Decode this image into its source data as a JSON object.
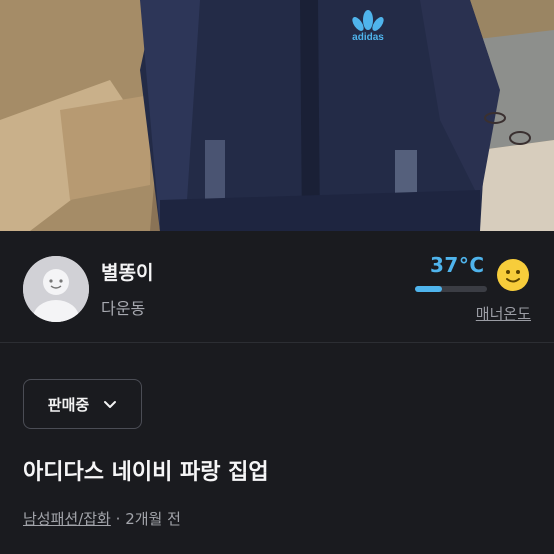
{
  "photo": {
    "brand_text": "adidas"
  },
  "seller": {
    "nickname": "별똥이",
    "region": "다운동"
  },
  "manner": {
    "temperature": "37°C",
    "temperature_value": 37,
    "bar_fill_fraction": 0.37,
    "label": "매너온도",
    "accent": "#4fb4ec"
  },
  "status": {
    "label": "판매중"
  },
  "post": {
    "title": "아디다스 네이비 파랑 집업",
    "category": "남성패션/잡화",
    "time": "2개월 전",
    "separator": "·"
  }
}
